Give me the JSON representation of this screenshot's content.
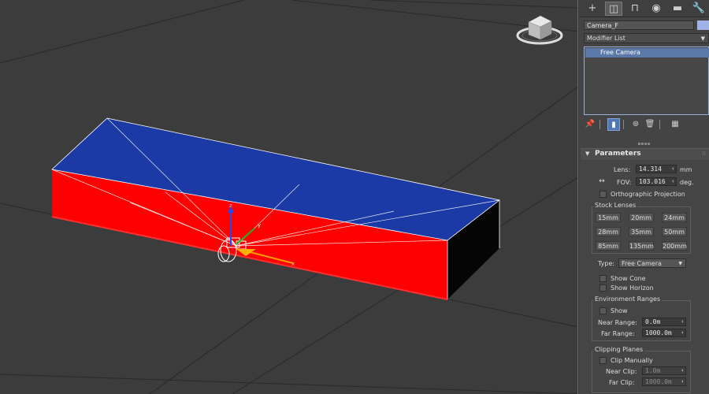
{
  "command_panel": {
    "tabs": [
      "create-icon",
      "modify-icon",
      "hierarchy-icon",
      "motion-icon",
      "display-icon",
      "utilities-icon"
    ],
    "object_name": "Camera_F",
    "object_color": "#9fb3e6",
    "modifier_list": "Modifier List",
    "stack": [
      "Free Camera"
    ]
  },
  "parameters": {
    "title": "Parameters",
    "lens_label": "Lens:",
    "lens_value": "14.314",
    "lens_unit": "mm",
    "fov_label": "FOV:",
    "fov_value": "103.016",
    "fov_unit": "deg.",
    "ortho_label": "Orthographic Projection",
    "stock_lenses_title": "Stock Lenses",
    "stock_lenses": [
      "15mm",
      "20mm",
      "24mm",
      "28mm",
      "35mm",
      "50mm",
      "85mm",
      "135mm",
      "200mm"
    ],
    "type_label": "Type:",
    "type_value": "Free Camera",
    "show_cone": "Show Cone",
    "show_horizon": "Show Horizon",
    "env_title": "Environment Ranges",
    "env_show": "Show",
    "near_range_label": "Near Range:",
    "near_range_value": "0.0m",
    "far_range_label": "Far Range:",
    "far_range_value": "1000.0m",
    "clip_title": "Clipping Planes",
    "clip_manually": "Clip Manually",
    "near_clip_label": "Near Clip:",
    "near_clip_value": "1.0m",
    "far_clip_label": "Far Clip:",
    "far_clip_value": "1000.0m"
  },
  "viewport": {
    "gizmo_x_label": "x",
    "gizmo_y_label": "y",
    "gizmo_z_label": "z",
    "colors": {
      "top_face": "#1b3aa6",
      "front_face": "#ff0000",
      "left_face": "#b59b00",
      "right_face": "#050505",
      "background": "#3c3c3c"
    }
  }
}
